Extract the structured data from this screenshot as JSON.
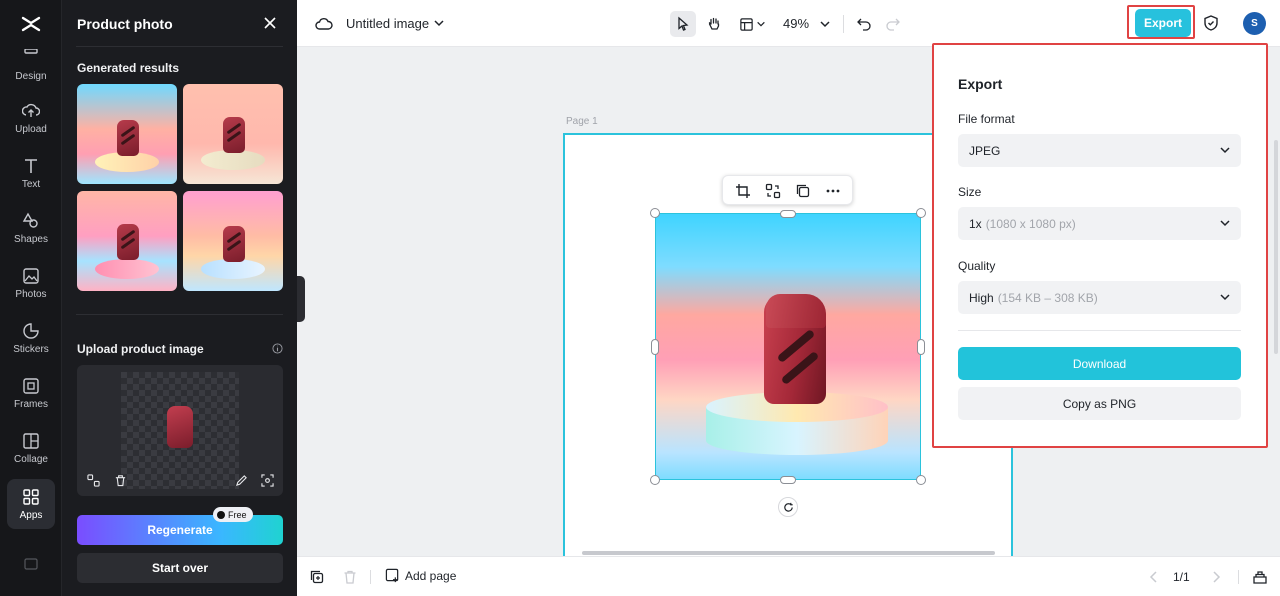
{
  "rail": {
    "items": [
      {
        "label": "Design",
        "icon": "design-icon"
      },
      {
        "label": "Upload",
        "icon": "upload-icon"
      },
      {
        "label": "Text",
        "icon": "text-icon"
      },
      {
        "label": "Shapes",
        "icon": "shapes-icon"
      },
      {
        "label": "Photos",
        "icon": "photos-icon"
      },
      {
        "label": "Stickers",
        "icon": "stickers-icon"
      },
      {
        "label": "Frames",
        "icon": "frames-icon"
      },
      {
        "label": "Collage",
        "icon": "collage-icon"
      },
      {
        "label": "Apps",
        "icon": "apps-icon",
        "active": true
      }
    ]
  },
  "panel": {
    "title": "Product photo",
    "generated_title": "Generated results",
    "upload_title": "Upload product image",
    "regenerate_label": "Regenerate",
    "free_badge": "Free",
    "start_over_label": "Start over"
  },
  "topbar": {
    "doc_title": "Untitled image",
    "zoom": "49%",
    "export_label": "Export",
    "avatar_initial": "S"
  },
  "canvas": {
    "page_label": "Page 1"
  },
  "export_panel": {
    "title": "Export",
    "file_format_label": "File format",
    "file_format_value": "JPEG",
    "size_label": "Size",
    "size_value": "1x",
    "size_detail": "(1080 x 1080 px)",
    "quality_label": "Quality",
    "quality_value": "High",
    "quality_detail": "(154 KB – 308 KB)",
    "download_label": "Download",
    "copy_label": "Copy as PNG"
  },
  "bottombar": {
    "add_page_label": "Add page",
    "page_count": "1/1"
  },
  "colors": {
    "accent": "#27c1dd",
    "highlight": "#e04343",
    "panel_bg": "#1b1c20"
  }
}
